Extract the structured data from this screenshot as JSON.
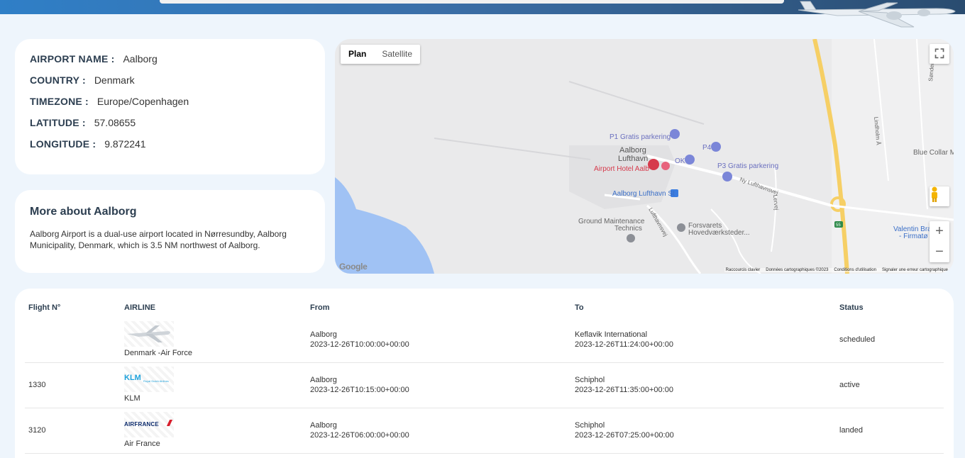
{
  "airport": {
    "rows": [
      {
        "key": "AIRPORT NAME :",
        "value": "Aalborg"
      },
      {
        "key": "COUNTRY :",
        "value": "Denmark"
      },
      {
        "key": "TIMEZONE :",
        "value": "Europe/Copenhagen"
      },
      {
        "key": "LATITUDE :",
        "value": "57.08655"
      },
      {
        "key": "LONGITUDE :",
        "value": "9.872241"
      }
    ]
  },
  "about": {
    "title": "More about Aalborg",
    "text": "Aalborg Airport is a dual-use airport located in Nørresundby, Aalborg Municipality, Denmark, which is 3.5 NM northwest of Aalborg."
  },
  "map": {
    "toggle": {
      "plan": "Plan",
      "satellite": "Satellite"
    },
    "labels": {
      "p1": "P1 Gratis parkering",
      "p4": "P4",
      "airport": "Aalborg\nLufthavn",
      "ok": "OK",
      "p3": "P3 Gratis parkering",
      "hotel": "Airport Hotel Aalb",
      "station": "Aalborg Lufthavn St",
      "ground": "Ground Maintenance\nTechnics",
      "forsvarets": "Forsvarets\nHovedværksteder...",
      "blue_collar": "Blue Collar M",
      "valentin": "Valentin Bra",
      "firmatoj": "- Firmatø",
      "lindholm": "Lindholm Å",
      "ny_lufthavnsvej": "Ny Lufthavnsvej",
      "lufthavnsvej": "Lufthavnsvej",
      "lervej": "Lervej",
      "route": "55",
      "sondergaard": "Søndergå"
    },
    "footer": [
      "Raccourcis clavier",
      "Données cartographiques ©2023",
      "Conditions d'utilisation",
      "Signaler une erreur cartographique"
    ],
    "google": "Google"
  },
  "flights": {
    "headers": {
      "flight": "Flight N°",
      "airline": "AIRLINE",
      "from": "From",
      "to": "To",
      "status": "Status"
    },
    "rows": [
      {
        "flight": "",
        "airline": "Denmark -Air Force",
        "logo": "air-force-plane-logo",
        "from_name": "Aalborg",
        "from_time": "2023-12-26T10:00:00+00:00",
        "to_name": "Keflavik International",
        "to_time": "2023-12-26T11:24:00+00:00",
        "status": "scheduled"
      },
      {
        "flight": "1330",
        "airline": "KLM",
        "logo": "klm-logo",
        "logo_text": "KLM",
        "logo_sub": "Royal Dutch Airlines",
        "from_name": "Aalborg",
        "from_time": "2023-12-26T10:15:00+00:00",
        "to_name": "Schiphol",
        "to_time": "2023-12-26T11:35:00+00:00",
        "status": "active"
      },
      {
        "flight": "3120",
        "airline": "Air France",
        "logo": "air-france-logo",
        "logo_text": "AIRFRANCE",
        "from_name": "Aalborg",
        "from_time": "2023-12-26T06:00:00+00:00",
        "to_name": "Schiphol",
        "to_time": "2023-12-26T07:25:00+00:00",
        "status": "landed"
      }
    ]
  },
  "colors": {
    "accent": "#2f7fc7",
    "heading": "#2c3e50",
    "map_bg": "#eaeaeb",
    "water": "#a0c2f4",
    "road_yellow": "#f6cf65"
  }
}
